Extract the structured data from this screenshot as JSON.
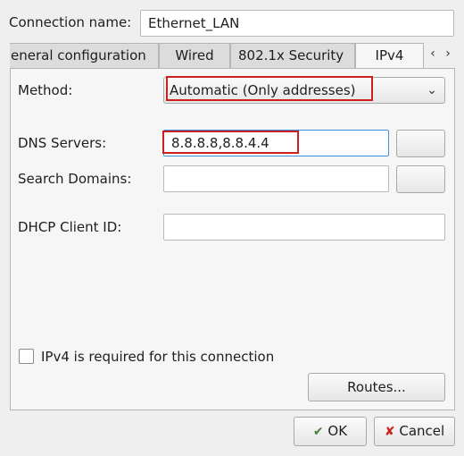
{
  "connection": {
    "name_label": "Connection name:",
    "name_value": "Ethernet_LAN"
  },
  "tabs": [
    {
      "label": "eneral configuration"
    },
    {
      "label": "Wired"
    },
    {
      "label": "802.1x Security"
    },
    {
      "label": "IPv4"
    }
  ],
  "tab_scroll": {
    "left_icon": "chevron-left-icon",
    "right_icon": "chevron-right-icon"
  },
  "ipv4": {
    "method_label": "Method:",
    "method_value": "Automatic (Only addresses)",
    "dns_label": "DNS Servers:",
    "dns_value": "8.8.8.8,8.8.4.4",
    "search_label": "Search Domains:",
    "search_value": "",
    "dhcp_label": "DHCP Client ID:",
    "dhcp_value": "",
    "required_label": "IPv4 is required for this connection",
    "required_checked": false,
    "routes_button": "Routes..."
  },
  "dialog_buttons": {
    "ok": "OK",
    "cancel": "Cancel"
  },
  "colors": {
    "highlight": "#cc1f1f",
    "background": "#efefef",
    "ok_icon": "#4b7d3a",
    "cancel_icon": "#c8231b"
  }
}
